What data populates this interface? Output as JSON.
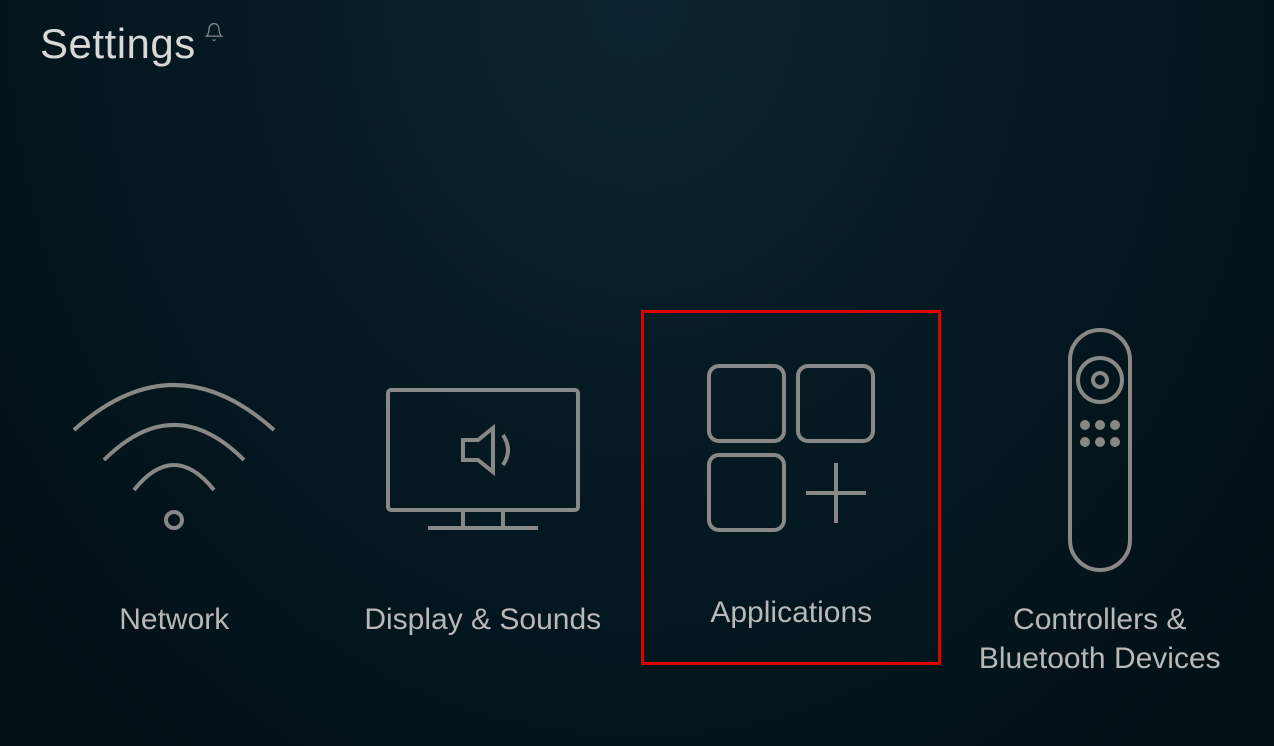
{
  "header": {
    "title": "Settings"
  },
  "tiles": [
    {
      "id": "network",
      "label": "Network",
      "icon": "wifi-icon",
      "highlighted": false
    },
    {
      "id": "display-sounds",
      "label": "Display & Sounds",
      "icon": "tv-speaker-icon",
      "highlighted": false
    },
    {
      "id": "applications",
      "label": "Applications",
      "icon": "apps-grid-icon",
      "highlighted": true
    },
    {
      "id": "controllers-bluetooth",
      "label": "Controllers & Bluetooth Devices",
      "icon": "remote-icon",
      "highlighted": false
    }
  ]
}
